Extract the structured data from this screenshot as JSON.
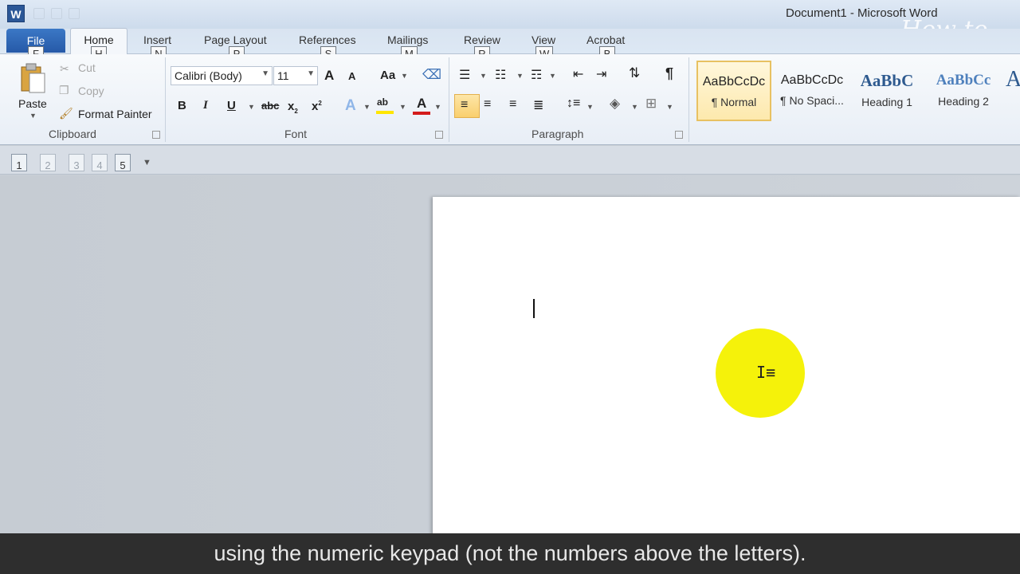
{
  "titlebar": {
    "app_icon": "W",
    "title": "Document1  -  Microsoft Word",
    "watermark": "How to"
  },
  "tabs": [
    {
      "label": "File",
      "keytip": "F"
    },
    {
      "label": "Home",
      "keytip": "H"
    },
    {
      "label": "Insert",
      "keytip": "N"
    },
    {
      "label": "Page Layout",
      "keytip": "P"
    },
    {
      "label": "References",
      "keytip": "S"
    },
    {
      "label": "Mailings",
      "keytip": "M"
    },
    {
      "label": "Review",
      "keytip": "R"
    },
    {
      "label": "View",
      "keytip": "W"
    },
    {
      "label": "Acrobat",
      "keytip": "B"
    }
  ],
  "clipboard": {
    "paste": "Paste",
    "cut": "Cut",
    "copy": "Copy",
    "format_painter": "Format Painter",
    "group_label": "Clipboard"
  },
  "font": {
    "font_name": "Calibri (Body)",
    "font_size": "11",
    "grow": "A",
    "shrink": "A",
    "change_case": "Aa",
    "bold": "B",
    "italic": "I",
    "underline": "U",
    "strike": "abc",
    "subscript": "x",
    "superscript": "x",
    "text_effects": "A",
    "highlight": "ab",
    "font_color": "A",
    "group_label": "Font"
  },
  "paragraph": {
    "group_label": "Paragraph",
    "show_marks": "¶"
  },
  "styles": [
    {
      "sample": "AaBbCcDc",
      "name": "¶ Normal"
    },
    {
      "sample": "AaBbCcDc",
      "name": "¶ No Spaci..."
    },
    {
      "sample": "AaBbC",
      "name": "Heading 1"
    },
    {
      "sample": "AaBbCc",
      "name": "Heading 2"
    }
  ],
  "strip": [
    "1",
    "2",
    "3",
    "4",
    "5"
  ],
  "caption": "using the numeric keypad (not the numbers above the letters).",
  "colors": {
    "file_tab": "#2b5fad",
    "highlight_circle": "#f5f20a",
    "highlight_bar": "#ffe600",
    "font_color_bar": "#d41c1c"
  }
}
